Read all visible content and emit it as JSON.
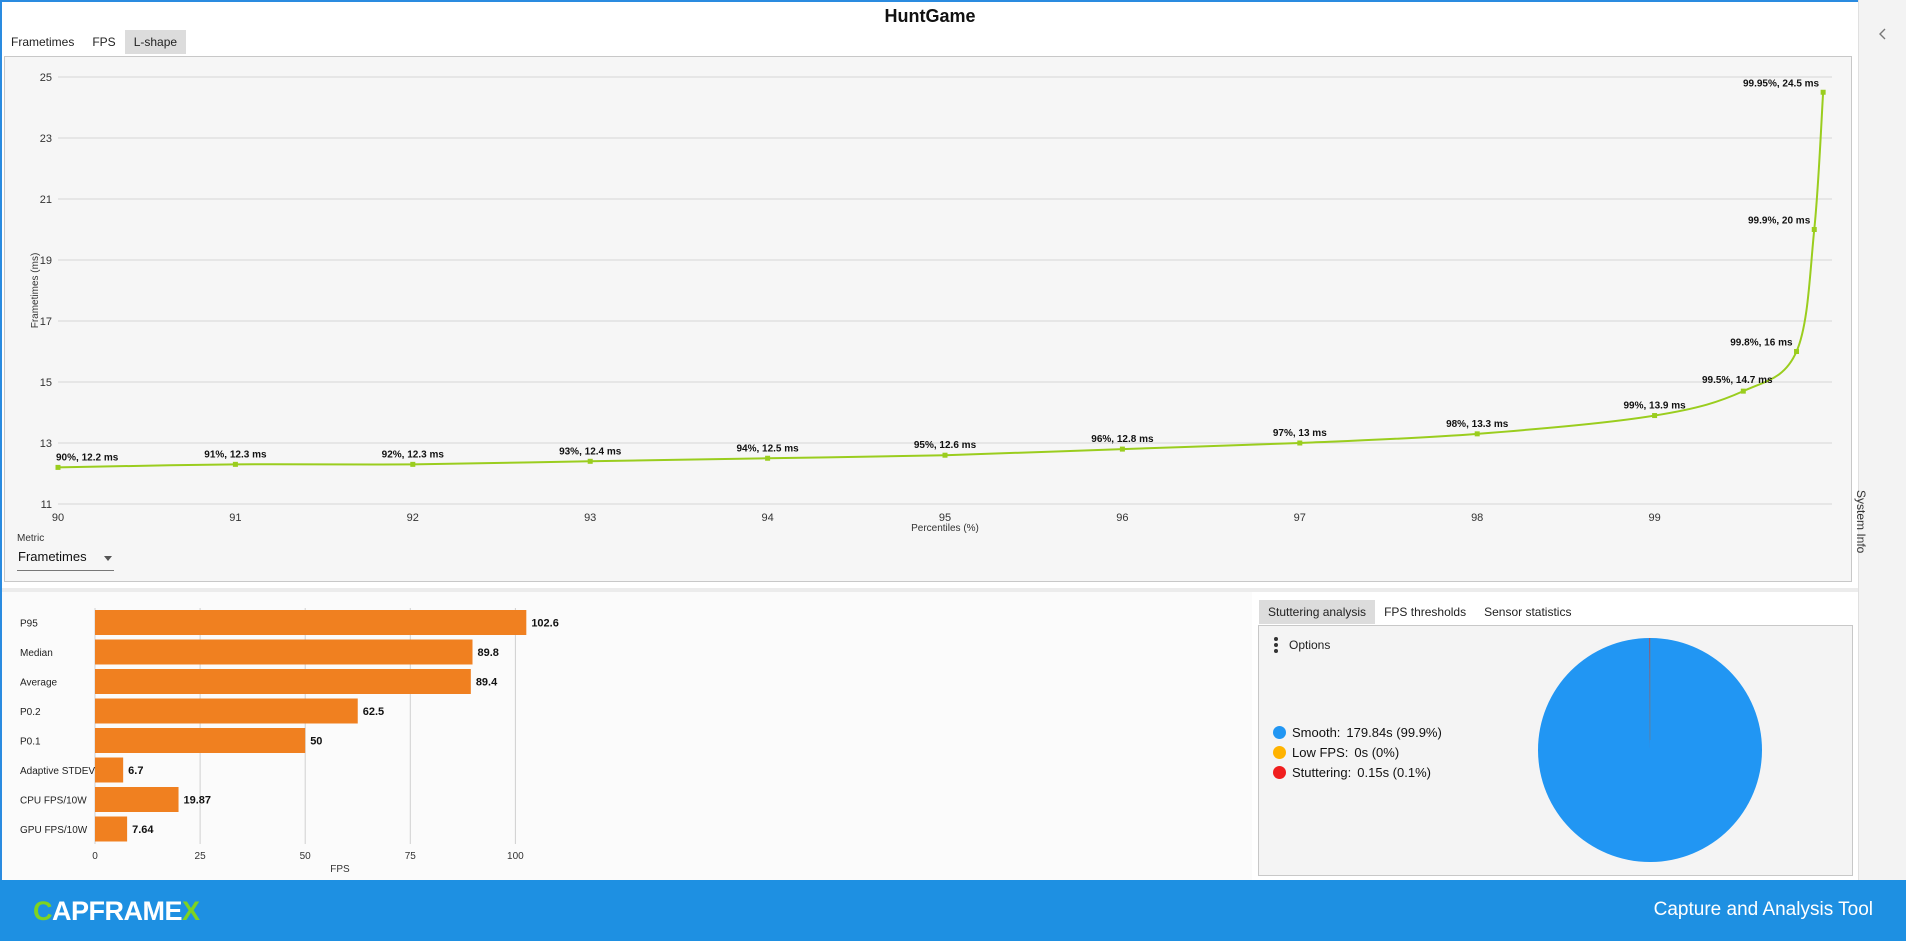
{
  "app": {
    "title": "HuntGame"
  },
  "tabs": [
    {
      "label": "Frametimes"
    },
    {
      "label": "FPS"
    },
    {
      "label": "L-shape"
    }
  ],
  "active_tab": 2,
  "metric": {
    "label": "Metric",
    "value": "Frametimes"
  },
  "sidebar": {
    "label": "System Info"
  },
  "bottom_tabs": [
    {
      "label": "Stuttering analysis"
    },
    {
      "label": "FPS thresholds"
    },
    {
      "label": "Sensor statistics"
    }
  ],
  "active_bottom_tab": 0,
  "options": {
    "label": "Options"
  },
  "stutter_legend": [
    {
      "name": "Smooth:",
      "value": "179.84s (99.9%)",
      "color": "#2196f3"
    },
    {
      "name": "Low FPS:",
      "value": "0s (0%)",
      "color": "#ffb300"
    },
    {
      "name": "Stuttering:",
      "value": "0.15s (0.1%)",
      "color": "#f01e1e"
    }
  ],
  "footer": {
    "logo_c": "C",
    "logo_mid": "APFRAME",
    "logo_x": "X",
    "tagline": "Capture and Analysis Tool"
  },
  "chart_data": [
    {
      "type": "line",
      "title": "",
      "xlabel": "Percentiles (%)",
      "ylabel": "Frametimes (ms)",
      "xlim": [
        90,
        100
      ],
      "ylim": [
        11,
        25
      ],
      "xticks": [
        90,
        91,
        92,
        93,
        94,
        95,
        96,
        97,
        98,
        99
      ],
      "yticks": [
        11,
        13,
        15,
        17,
        19,
        21,
        23,
        25
      ],
      "color": "#9acd1e",
      "grid": true,
      "points": [
        {
          "x": 90,
          "y": 12.2,
          "label": "90%, 12.2 ms"
        },
        {
          "x": 91,
          "y": 12.3,
          "label": "91%, 12.3 ms"
        },
        {
          "x": 92,
          "y": 12.3,
          "label": "92%, 12.3 ms"
        },
        {
          "x": 93,
          "y": 12.4,
          "label": "93%, 12.4 ms"
        },
        {
          "x": 94,
          "y": 12.5,
          "label": "94%, 12.5 ms"
        },
        {
          "x": 95,
          "y": 12.6,
          "label": "95%, 12.6 ms"
        },
        {
          "x": 96,
          "y": 12.8,
          "label": "96%, 12.8 ms"
        },
        {
          "x": 97,
          "y": 13,
          "label": "97%, 13 ms"
        },
        {
          "x": 98,
          "y": 13.3,
          "label": "98%, 13.3 ms"
        },
        {
          "x": 99,
          "y": 13.9,
          "label": "99%, 13.9 ms"
        },
        {
          "x": 99.5,
          "y": 14.7,
          "label": "99.5%, 14.7 ms"
        },
        {
          "x": 99.8,
          "y": 16,
          "label": "99.8%, 16 ms"
        },
        {
          "x": 99.9,
          "y": 20,
          "label": "99.9%, 20 ms"
        },
        {
          "x": 99.95,
          "y": 24.5,
          "label": "99.95%, 24.5 ms"
        }
      ]
    },
    {
      "type": "bar",
      "orientation": "horizontal",
      "title": "",
      "xlabel": "FPS",
      "xlim": [
        0,
        103
      ],
      "xticks": [
        0,
        25,
        50,
        75,
        100
      ],
      "color": "#f08020",
      "categories": [
        "P95",
        "Median",
        "Average",
        "P0.2",
        "P0.1",
        "Adaptive STDEV",
        "CPU FPS/10W",
        "GPU FPS/10W"
      ],
      "values": [
        102.6,
        89.8,
        89.4,
        62.5,
        50,
        6.7,
        19.87,
        7.64
      ]
    },
    {
      "type": "pie",
      "title": "",
      "labels": [
        "Smooth",
        "Low FPS",
        "Stuttering"
      ],
      "values": [
        99.9,
        0,
        0.1
      ],
      "colors": [
        "#2196f3",
        "#ffb300",
        "#f01e1e"
      ]
    }
  ]
}
